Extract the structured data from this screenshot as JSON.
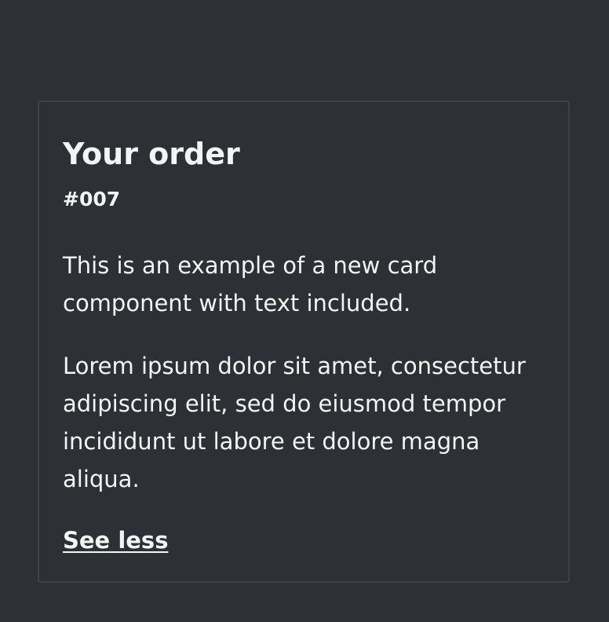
{
  "card": {
    "title": "Your order",
    "order_number": "#007",
    "paragraphs": [
      "This is an example of a new card component with text included.",
      "Lorem ipsum dolor sit amet, consectetur adipiscing elit, sed do eiusmod tempor incididunt ut labore et dolore magna aliqua."
    ],
    "toggle_label": "See less"
  },
  "colors": {
    "background": "#2d3035",
    "card_border": "#3f4349",
    "text": "#f3f4f5"
  }
}
